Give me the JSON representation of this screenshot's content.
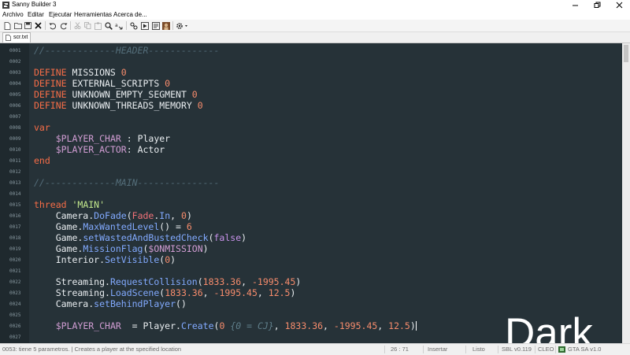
{
  "window": {
    "title": "Sanny Builder 3"
  },
  "menu": {
    "items": [
      "Archivo",
      "Editar",
      "Ejecutar",
      "Herramientas",
      "Acerca de..."
    ]
  },
  "toolbar": {
    "icons": [
      "new-file-icon",
      "open-folder-icon",
      "save-icon",
      "close-icon",
      "undo-icon",
      "redo-icon",
      "cut-icon",
      "copy-icon",
      "paste-icon",
      "search-icon",
      "replace-icon",
      "compile-icon",
      "compile-run-icon",
      "decompile-icon",
      "game-icon",
      "settings-icon"
    ]
  },
  "tab": {
    "label": "scr.txt"
  },
  "editor": {
    "lines": [
      {
        "n": "0001",
        "tokens": [
          [
            "comment",
            "//-------------HEADER-------------"
          ]
        ]
      },
      {
        "n": "0002",
        "tokens": []
      },
      {
        "n": "0003",
        "tokens": [
          [
            "kw",
            "DEFINE"
          ],
          [
            "plain",
            " MISSIONS "
          ],
          [
            "num",
            "0"
          ]
        ]
      },
      {
        "n": "0004",
        "tokens": [
          [
            "kw",
            "DEFINE"
          ],
          [
            "plain",
            " EXTERNAL_SCRIPTS "
          ],
          [
            "num",
            "0"
          ]
        ]
      },
      {
        "n": "0005",
        "tokens": [
          [
            "kw",
            "DEFINE"
          ],
          [
            "plain",
            " UNKNOWN_EMPTY_SEGMENT "
          ],
          [
            "num",
            "0"
          ]
        ]
      },
      {
        "n": "0006",
        "tokens": [
          [
            "kw",
            "DEFINE"
          ],
          [
            "plain",
            " UNKNOWN_THREADS_MEMORY "
          ],
          [
            "num",
            "0"
          ]
        ]
      },
      {
        "n": "0007",
        "tokens": []
      },
      {
        "n": "0008",
        "tokens": [
          [
            "kw",
            "var"
          ]
        ]
      },
      {
        "n": "0009",
        "tokens": [
          [
            "plain",
            "    "
          ],
          [
            "var",
            "$PLAYER_CHAR"
          ],
          [
            "plain",
            " : Player"
          ]
        ]
      },
      {
        "n": "0010",
        "tokens": [
          [
            "plain",
            "    "
          ],
          [
            "var",
            "$PLAYER_ACTOR"
          ],
          [
            "plain",
            ": Actor"
          ]
        ]
      },
      {
        "n": "0011",
        "tokens": [
          [
            "kw",
            "end"
          ]
        ]
      },
      {
        "n": "0012",
        "tokens": []
      },
      {
        "n": "0013",
        "tokens": [
          [
            "comment",
            "//-------------MAIN---------------"
          ]
        ]
      },
      {
        "n": "0014",
        "tokens": []
      },
      {
        "n": "0015",
        "tokens": [
          [
            "kw",
            "thread"
          ],
          [
            "plain",
            " "
          ],
          [
            "str",
            "'MAIN'"
          ]
        ]
      },
      {
        "n": "0016",
        "tokens": [
          [
            "plain",
            "    Camera."
          ],
          [
            "fn",
            "DoFade"
          ],
          [
            "plain",
            "("
          ],
          [
            "arg",
            "Fade"
          ],
          [
            "plain",
            "."
          ],
          [
            "fn",
            "In"
          ],
          [
            "plain",
            ", "
          ],
          [
            "num",
            "0"
          ],
          [
            "plain",
            ")"
          ]
        ]
      },
      {
        "n": "0017",
        "tokens": [
          [
            "plain",
            "    Game."
          ],
          [
            "fn",
            "MaxWantedLevel"
          ],
          [
            "plain",
            "() = "
          ],
          [
            "num",
            "6"
          ]
        ]
      },
      {
        "n": "0018",
        "tokens": [
          [
            "plain",
            "    Game."
          ],
          [
            "fn",
            "setWastedAndBustedCheck"
          ],
          [
            "plain",
            "("
          ],
          [
            "bool",
            "false"
          ],
          [
            "plain",
            ")"
          ]
        ]
      },
      {
        "n": "0019",
        "tokens": [
          [
            "plain",
            "    Game."
          ],
          [
            "fn",
            "MissionFlag"
          ],
          [
            "plain",
            "("
          ],
          [
            "var",
            "$ONMISSION"
          ],
          [
            "plain",
            ")"
          ]
        ]
      },
      {
        "n": "0020",
        "tokens": [
          [
            "plain",
            "    Interior."
          ],
          [
            "fn",
            "SetVisible"
          ],
          [
            "plain",
            "("
          ],
          [
            "num",
            "0"
          ],
          [
            "plain",
            ")"
          ]
        ]
      },
      {
        "n": "0021",
        "tokens": []
      },
      {
        "n": "0022",
        "tokens": [
          [
            "plain",
            "    Streaming."
          ],
          [
            "fn",
            "RequestCollision"
          ],
          [
            "plain",
            "("
          ],
          [
            "num",
            "1833.36"
          ],
          [
            "plain",
            ", "
          ],
          [
            "num",
            "-1995.45"
          ],
          [
            "plain",
            ")"
          ]
        ]
      },
      {
        "n": "0023",
        "tokens": [
          [
            "plain",
            "    Streaming."
          ],
          [
            "fn",
            "LoadScene"
          ],
          [
            "plain",
            "("
          ],
          [
            "num",
            "1833.36"
          ],
          [
            "plain",
            ", "
          ],
          [
            "num",
            "-1995.45"
          ],
          [
            "plain",
            ", "
          ],
          [
            "num",
            "12.5"
          ],
          [
            "plain",
            ")"
          ]
        ]
      },
      {
        "n": "0024",
        "tokens": [
          [
            "plain",
            "    Camera."
          ],
          [
            "fn",
            "setBehindPlayer"
          ],
          [
            "plain",
            "()"
          ]
        ]
      },
      {
        "n": "0025",
        "tokens": []
      },
      {
        "n": "0026",
        "tokens": [
          [
            "plain",
            "    "
          ],
          [
            "var",
            "$PLAYER_CHAR"
          ],
          [
            "plain",
            "  = Player."
          ],
          [
            "fn",
            "Create"
          ],
          [
            "plain",
            "("
          ],
          [
            "num",
            "0"
          ],
          [
            "plain",
            " "
          ],
          [
            "inline",
            "{0 = CJ}"
          ],
          [
            "plain",
            ", "
          ],
          [
            "num",
            "1833.36"
          ],
          [
            "plain",
            ", "
          ],
          [
            "num",
            "-1995.45"
          ],
          [
            "plain",
            ", "
          ],
          [
            "num",
            "12.5"
          ],
          [
            "plain",
            ")"
          ],
          [
            "cursor",
            ""
          ]
        ]
      },
      {
        "n": "0027",
        "tokens": []
      }
    ]
  },
  "overlay": {
    "caption": "Dark"
  },
  "status": {
    "hint": "0053: tiene 5 parametros. | Creates a player at the specified location",
    "position": "26 : 71",
    "mode": "Insertar",
    "state": "Listo",
    "sbl": "SBL v0.119",
    "cleo": "CLEO",
    "game": "GTA SA v1.0"
  },
  "colors": {
    "editor_bg": "#263238",
    "keyword": "#f76d47",
    "number": "#f78c6c",
    "variable": "#d19dd3",
    "string": "#c3e88d",
    "function": "#82aaff",
    "comment": "#546e7a"
  }
}
